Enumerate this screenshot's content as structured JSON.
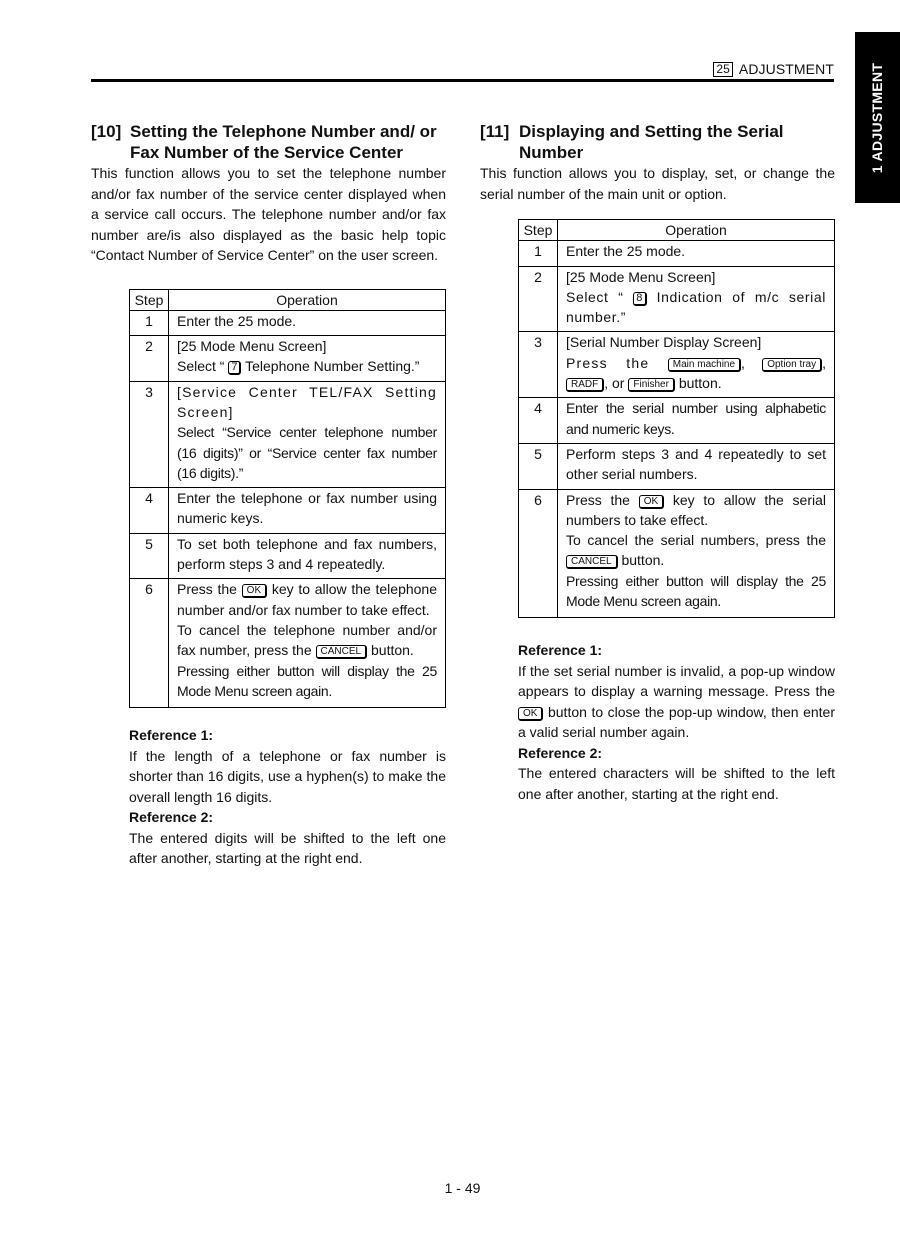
{
  "header": {
    "mode_number": "25",
    "section_label": "ADJUSTMENT"
  },
  "side_tab": {
    "label": "1 ADJUSTMENT"
  },
  "section10": {
    "number": "[10]",
    "title": "Setting the Telephone Number and/ or Fax Number of the Service Center",
    "intro": "This function allows you to set the telephone number and/or fax number of the service center displayed when a service call occurs.  The telephone number and/or fax number are/is also displayed as the basic help topic “Contact Number of Service Center” on the user screen.",
    "table": {
      "headers": [
        "Step",
        "Operation"
      ],
      "rows": [
        {
          "step": "1",
          "lines": [
            "Enter the 25 mode."
          ]
        },
        {
          "step": "2",
          "lines": [
            "[25 Mode Menu Screen]"
          ],
          "select_prefix": "Select “ ",
          "key": "7",
          "select_suffix": " Telephone Number Setting.”"
        },
        {
          "step": "3",
          "lines": [
            "[Service Center TEL/FAX Setting Screen]",
            "Select “Service center telephone number (16 digits)” or “Service center fax number (16 digits).”"
          ]
        },
        {
          "step": "4",
          "lines": [
            "Enter the telephone or fax number using numeric keys."
          ]
        },
        {
          "step": "5",
          "lines": [
            "To set both telephone and fax numbers, perform steps 3 and 4 repeatedly."
          ]
        },
        {
          "step": "6",
          "press_prefix": "Press the ",
          "ok_key": "OK",
          "press_suffix": " key to allow the telephone number and/or fax number to take effect.",
          "cancel_prefix": "To cancel the telephone number and/or fax number, press the ",
          "cancel_key": "CANCEL",
          "cancel_suffix": " button.",
          "last": "Pressing either button will display the 25 Mode Menu screen again."
        }
      ]
    },
    "reference1_heading": "Reference 1:",
    "reference1_text": "If the length of a telephone or fax number is shorter than 16 digits, use a hyphen(s) to make the overall length 16 digits.",
    "reference2_heading": "Reference 2:",
    "reference2_text": "The entered digits will be shifted to the left one after another, starting at the right end."
  },
  "section11": {
    "number": "[11]",
    "title": "Displaying and Setting the Serial Number",
    "intro": "This function allows you to display, set, or change the serial number of the main unit or option.",
    "table": {
      "headers": [
        "Step",
        "Operation"
      ],
      "rows": [
        {
          "step": "1",
          "lines": [
            "Enter the 25 mode."
          ]
        },
        {
          "step": "2",
          "lines": [
            "[25 Mode Menu Screen]"
          ],
          "select_prefix": "Select “ ",
          "key": "8",
          "select_suffix": " Indication of m/c serial number.”"
        },
        {
          "step": "3",
          "lines": [
            "[Serial Number Display Screen]"
          ],
          "press_prefix": "Press the ",
          "keys": [
            "Main machine",
            "Option tray",
            "RADF",
            "Finisher"
          ],
          "sep1": ", ",
          "sep2": ", ",
          "sep3": ", or ",
          "press_suffix": " button."
        },
        {
          "step": "4",
          "lines": [
            "Enter the serial number using alphabetic and numeric keys."
          ]
        },
        {
          "step": "5",
          "lines": [
            "Perform steps 3 and 4 repeatedly to set other serial numbers."
          ]
        },
        {
          "step": "6",
          "press_prefix": "Press the ",
          "ok_key": "OK",
          "press_suffix": " key to allow the serial numbers to take effect.",
          "cancel_prefix": "To cancel the serial numbers, press the ",
          "cancel_key": "CANCEL",
          "cancel_suffix": " button.",
          "last": "Pressing either button will display the 25 Mode Menu screen again."
        }
      ]
    },
    "reference1_heading": "Reference 1:",
    "reference1_prefix": "If the set serial number is invalid, a pop-up window appears to display a warning message. Press the ",
    "reference1_key": "OK",
    "reference1_suffix": " button to close the pop-up window, then enter a valid serial number again.",
    "reference2_heading": "Reference 2:",
    "reference2_text": "The entered characters will be shifted to the left one after another, starting at the right end."
  },
  "footer": {
    "page_number": "1 - 49"
  }
}
